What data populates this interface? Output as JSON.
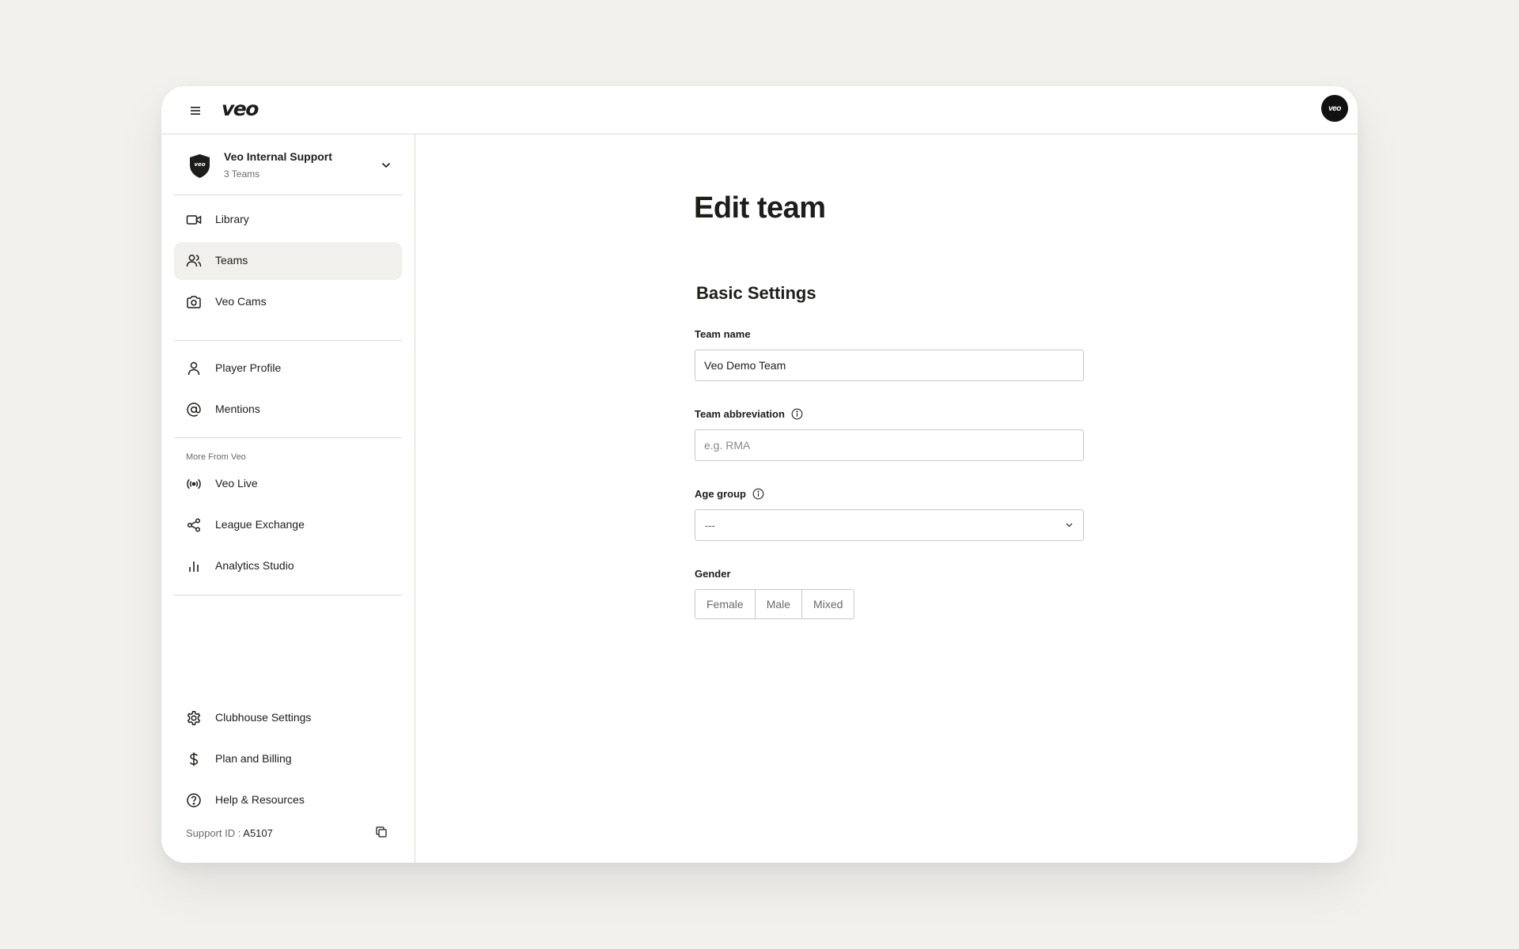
{
  "app": {
    "logo": "veo",
    "avatar_text": "veo"
  },
  "club": {
    "name": "Veo Internal Support",
    "subtitle": "3 Teams",
    "shield_text": "veo"
  },
  "nav": {
    "primary": [
      {
        "label": "Library",
        "icon": "video-camera-icon"
      },
      {
        "label": "Teams",
        "icon": "users-icon",
        "active": true
      },
      {
        "label": "Veo Cams",
        "icon": "camera-icon"
      }
    ],
    "secondary": [
      {
        "label": "Player Profile",
        "icon": "user-icon"
      },
      {
        "label": "Mentions",
        "icon": "at-sign-icon"
      }
    ],
    "more_heading": "More From Veo",
    "more": [
      {
        "label": "Veo Live",
        "icon": "broadcast-icon"
      },
      {
        "label": "League Exchange",
        "icon": "share-icon"
      },
      {
        "label": "Analytics Studio",
        "icon": "bar-chart-icon"
      }
    ],
    "bottom": [
      {
        "label": "Clubhouse Settings",
        "icon": "gear-icon"
      },
      {
        "label": "Plan and Billing",
        "icon": "dollar-icon"
      },
      {
        "label": "Help & Resources",
        "icon": "help-circle-icon"
      }
    ]
  },
  "support": {
    "label": "Support ID",
    "separator": " : ",
    "id": "A5107"
  },
  "page": {
    "title": "Edit team",
    "section": "Basic Settings",
    "team_name": {
      "label": "Team name",
      "value": "Veo Demo Team"
    },
    "team_abbreviation": {
      "label": "Team abbreviation",
      "placeholder": "e.g. RMA",
      "value": ""
    },
    "age_group": {
      "label": "Age group",
      "value": "---"
    },
    "gender": {
      "label": "Gender",
      "options": [
        "Female",
        "Male",
        "Mixed"
      ]
    }
  }
}
